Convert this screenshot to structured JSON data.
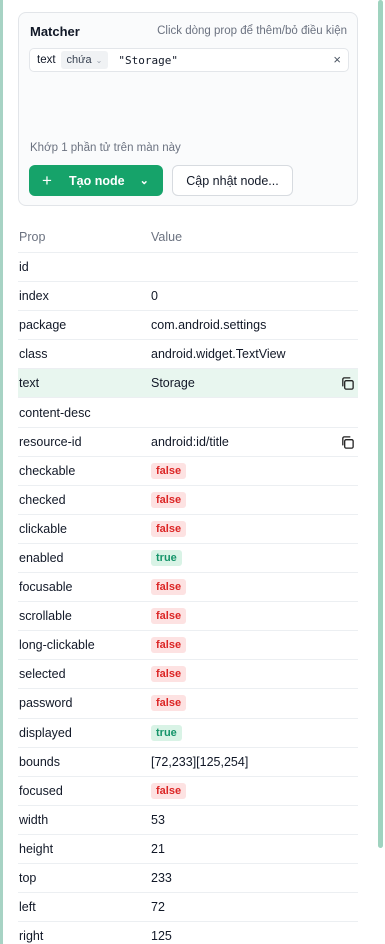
{
  "matcher": {
    "title": "Matcher",
    "hint": "Click dòng prop để thêm/bỏ điều kiện",
    "condition": {
      "prop": "text",
      "operator": "chứa",
      "value": "\"Storage\""
    },
    "match_status": "Khớp 1 phần tử trên màn này",
    "create_button": "Tạo node",
    "update_button": "Cập nhật node..."
  },
  "table": {
    "headers": {
      "prop": "Prop",
      "value": "Value"
    },
    "rows": [
      {
        "prop": "id",
        "value": ""
      },
      {
        "prop": "index",
        "value": "0"
      },
      {
        "prop": "package",
        "value": "com.android.settings"
      },
      {
        "prop": "class",
        "value": "android.widget.TextView"
      },
      {
        "prop": "text",
        "value": "Storage"
      },
      {
        "prop": "content-desc",
        "value": ""
      },
      {
        "prop": "resource-id",
        "value": "android:id/title"
      },
      {
        "prop": "checkable",
        "value": "false"
      },
      {
        "prop": "checked",
        "value": "false"
      },
      {
        "prop": "clickable",
        "value": "false"
      },
      {
        "prop": "enabled",
        "value": "true"
      },
      {
        "prop": "focusable",
        "value": "false"
      },
      {
        "prop": "scrollable",
        "value": "false"
      },
      {
        "prop": "long-clickable",
        "value": "false"
      },
      {
        "prop": "selected",
        "value": "false"
      },
      {
        "prop": "password",
        "value": "false"
      },
      {
        "prop": "displayed",
        "value": "true"
      },
      {
        "prop": "bounds",
        "value": "[72,233][125,254]"
      },
      {
        "prop": "focused",
        "value": "false"
      },
      {
        "prop": "width",
        "value": "53"
      },
      {
        "prop": "height",
        "value": "21"
      },
      {
        "prop": "top",
        "value": "233"
      },
      {
        "prop": "left",
        "value": "72"
      },
      {
        "prop": "right",
        "value": "125"
      }
    ]
  },
  "colors": {
    "accent": "#16a36a",
    "highlight": "#e8f6ef",
    "false_badge": "#dc2626",
    "true_badge": "#15946a"
  }
}
